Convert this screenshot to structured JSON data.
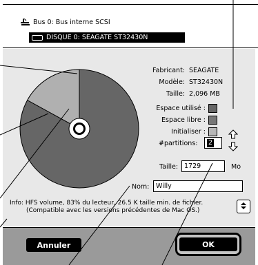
{
  "header": {
    "bus_label": "Bus 0: Bus interne SCSI",
    "disk_label": "DISQUE 0: SEAGATE ST32430N"
  },
  "disk_info": {
    "fabricant_label": "Fabricant:",
    "fabricant_value": "SEAGATE",
    "modele_label": "Modèle:",
    "modele_value": "ST32430N",
    "taille_label": "Taille:",
    "taille_value": "2,096 MB"
  },
  "legend": {
    "used_label": "Espace utilisé :",
    "free_label": "Espace libre :",
    "init_label": "Initialiser :",
    "used_color": "#666666",
    "free_color": "#777777",
    "init_color": "#b7b7b7"
  },
  "partitions": {
    "label": "#partitions:",
    "value": "2"
  },
  "size_field": {
    "label": "Taille:",
    "value": "1729",
    "unit": "Mo"
  },
  "name_field": {
    "label": "Nom:",
    "value": "Willy"
  },
  "info_text": {
    "line1": "Info: HFS volume, 83% du lecteur, 26.5 K taille min. de fichier.",
    "line2": "(Compatible avec les versions précédentes de Mac OS.)"
  },
  "pie": {
    "used_fraction": 0.83,
    "small_fraction": 0.17
  },
  "buttons": {
    "cancel": "Annuler",
    "ok": "OK"
  }
}
